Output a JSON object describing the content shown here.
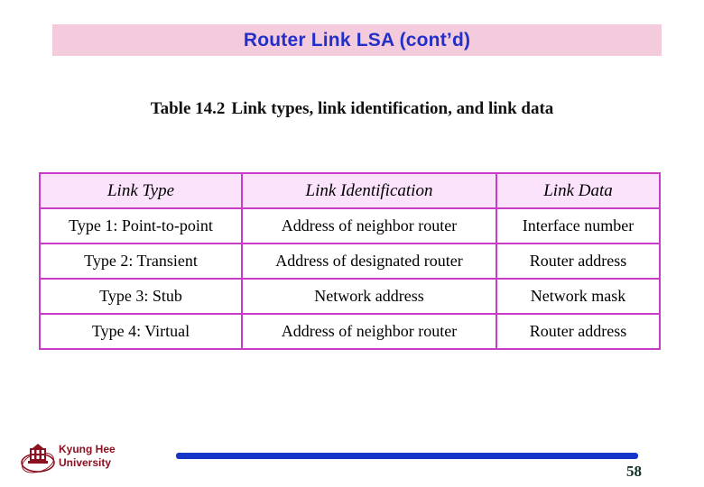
{
  "slide": {
    "title": "Router Link LSA (cont’d)",
    "title_band_color": "#f4cadd",
    "title_text_color": "#2330c8"
  },
  "caption": {
    "number": "Table 14.2",
    "text": "Link types, link identification, and link data"
  },
  "table": {
    "border_color": "#c83cc8",
    "header_background": "#fbe3fb",
    "headers": [
      "Link Type",
      "Link Identification",
      "Link Data"
    ],
    "rows": [
      [
        "Type 1: Point-to-point",
        "Address of neighbor router",
        "Interface number"
      ],
      [
        "Type 2: Transient",
        "Address of designated router",
        "Router address"
      ],
      [
        "Type 3: Stub",
        "Network address",
        "Network mask"
      ],
      [
        "Type 4: Virtual",
        "Address of neighbor router",
        "Router address"
      ]
    ]
  },
  "footer": {
    "logo_icon": "university-crest-icon",
    "org_line1": "Kyung Hee",
    "org_line2": "University",
    "org_color": "#8b1021",
    "rule_color": "#1535c8",
    "page_number": "58",
    "page_number_color": "#0f3322"
  }
}
